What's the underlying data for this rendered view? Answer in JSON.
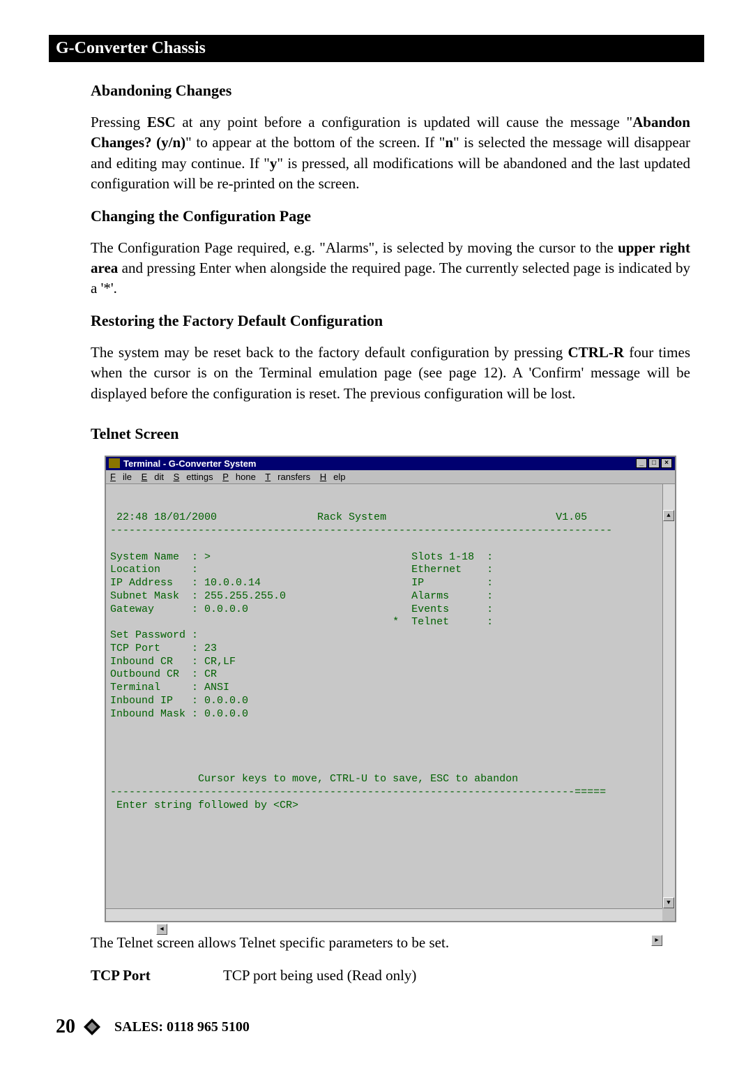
{
  "header_title": "G-Converter Chassis",
  "sections": {
    "abandon": {
      "heading": "Abandoning Changes",
      "p1_a": "Pressing ",
      "p1_esc": "ESC",
      "p1_b": " at any point before a configuration is updated will cause the message \"",
      "p1_abandon": "Abandon Changes? (y/n)",
      "p1_c": "\" to appear at the bottom of the screen. If \"",
      "p1_n": "n",
      "p1_d": "\" is selected the message will disappear and editing may continue. If \"",
      "p1_y": "y",
      "p1_e": "\" is pressed, all modifications will be abandoned and the last updated configuration will be re-printed on the screen."
    },
    "changing": {
      "heading": "Changing the Configuration Page",
      "p1_a": "The Configuration Page required, e.g. \"Alarms\", is selected by moving the cursor to the ",
      "p1_upper": "upper right area",
      "p1_b": " and pressing Enter when alongside the required page. The currently selected page is indicated by a '*'."
    },
    "restoring": {
      "heading": "Restoring the Factory Default Configuration",
      "p1_a": "The system may be reset back to the factory default configuration by pressing ",
      "p1_ctrlr": "CTRL-R",
      "p1_b": " four times when the cursor is on the Terminal emulation page (see page 12). A 'Confirm' message will be displayed before the configuration is reset. The previous configuration will be lost."
    },
    "telnet": {
      "heading": "Telnet Screen",
      "caption": "The Telnet screen allows Telnet specific parameters to be set."
    }
  },
  "terminal": {
    "title": "Terminal - G-Converter System",
    "menu": {
      "file": "File",
      "edit": "Edit",
      "settings": "Settings",
      "phone": "Phone",
      "transfers": "Transfers",
      "help": "Help"
    },
    "datetime": " 22:48 18/01/2000",
    "center_title": "Rack System",
    "version": "V1.05",
    "divider": "--------------------------------------------------------------------------------",
    "left_fields": [
      {
        "label": "System Name",
        "value": ">"
      },
      {
        "label": "Location",
        "value": ""
      },
      {
        "label": "IP Address",
        "value": "10.0.0.14"
      },
      {
        "label": "Subnet Mask",
        "value": "255.255.255.0"
      },
      {
        "label": "Gateway",
        "value": "0.0.0.0"
      }
    ],
    "right_fields": [
      {
        "label": "Slots 1-18",
        "mark": " "
      },
      {
        "label": "Ethernet",
        "mark": " "
      },
      {
        "label": "IP",
        "mark": " "
      },
      {
        "label": "Alarms",
        "mark": " "
      },
      {
        "label": "Events",
        "mark": " "
      },
      {
        "label": "Telnet",
        "mark": "*"
      }
    ],
    "bottom_fields": [
      {
        "label": "Set Password",
        "value": ""
      },
      {
        "label": "TCP Port",
        "value": "23"
      },
      {
        "label": "Inbound CR",
        "value": "CR,LF"
      },
      {
        "label": "Outbound CR",
        "value": "CR"
      },
      {
        "label": "Terminal",
        "value": "ANSI"
      },
      {
        "label": "Inbound IP",
        "value": "0.0.0.0"
      },
      {
        "label": "Inbound Mask",
        "value": "0.0.0.0"
      }
    ],
    "hint": "Cursor keys to move, CTRL-U to save, ESC to abandon",
    "divider2": "--------------------------------------------------------------------------=====",
    "prompt": " Enter string followed by <CR>"
  },
  "def": {
    "label": "TCP Port",
    "desc": "TCP port being used (Read only)"
  },
  "footer": {
    "page": "20",
    "text": "SALES: 0118 965 5100"
  }
}
